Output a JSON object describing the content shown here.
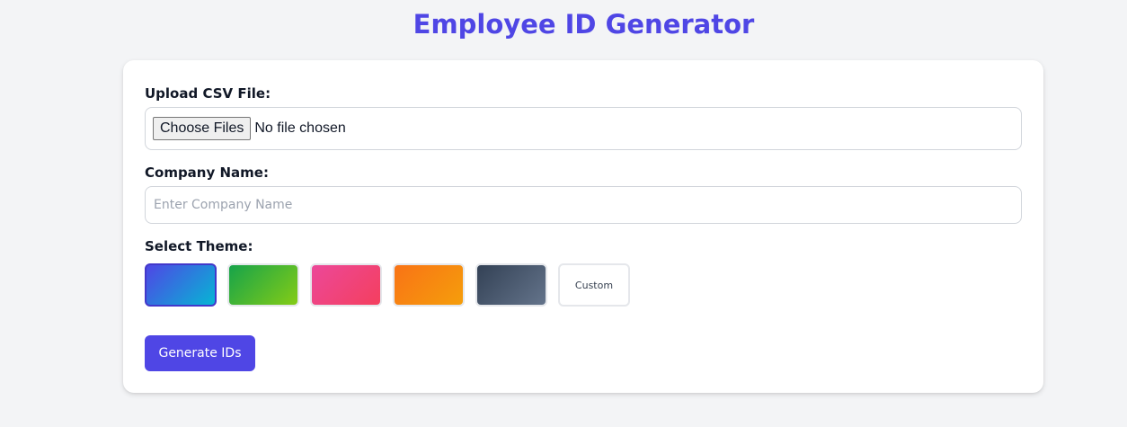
{
  "header": {
    "title": "Employee ID Generator"
  },
  "form": {
    "csv_label": "Upload CSV File:",
    "file_button_label": "Choose Files",
    "file_status": "No file chosen",
    "company_label": "Company Name:",
    "company_value": "",
    "company_placeholder": "Enter Company Name",
    "theme_label": "Select Theme:",
    "themes": [
      {
        "name": "blue-cyan",
        "colors": [
          "#4f46e5",
          "#06b6d4"
        ],
        "selected": true
      },
      {
        "name": "green-lime",
        "colors": [
          "#16a34a",
          "#84cc16"
        ],
        "selected": false
      },
      {
        "name": "pink-rose",
        "colors": [
          "#ec4899",
          "#f43f5e"
        ],
        "selected": false
      },
      {
        "name": "orange-amber",
        "colors": [
          "#f97316",
          "#f59e0b"
        ],
        "selected": false
      },
      {
        "name": "slate",
        "colors": [
          "#334155",
          "#64748b"
        ],
        "selected": false
      }
    ],
    "custom_theme_label": "Custom",
    "generate_label": "Generate IDs"
  },
  "colors": {
    "accent": "#4f46e5",
    "background": "#f3f4f6",
    "card": "#ffffff",
    "border": "#d1d5db"
  }
}
